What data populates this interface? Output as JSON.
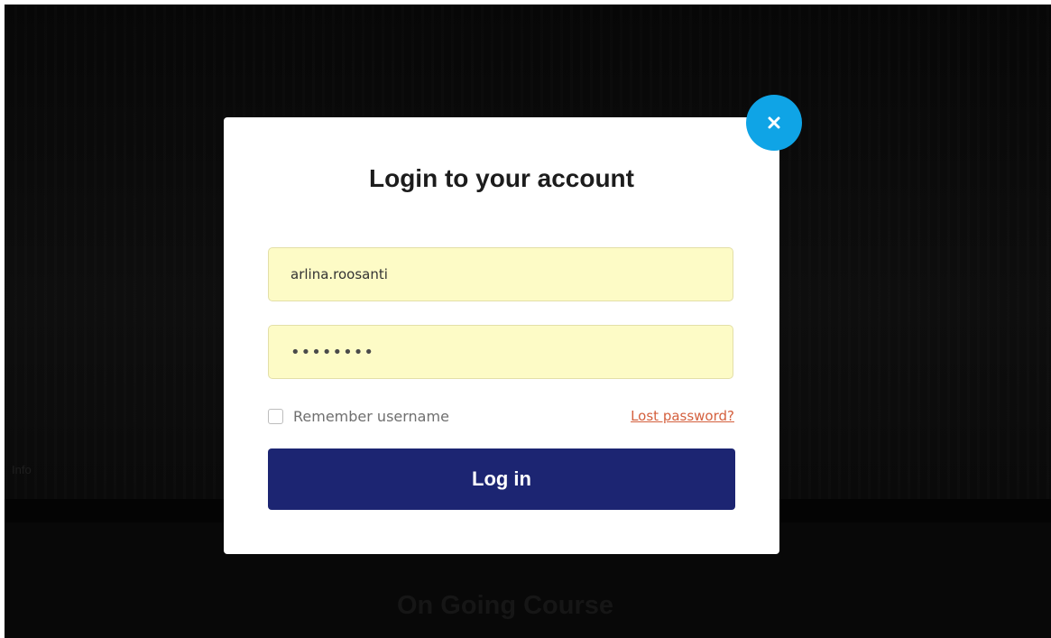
{
  "background": {
    "hero_caption": "Info",
    "section_title": "On Going Course"
  },
  "login_modal": {
    "title": "Login to your account",
    "username_value": "arlina.roosanti",
    "password_value": "••••••••",
    "remember_label": "Remember username",
    "remember_checked": false,
    "lost_password_label": "Lost password?",
    "login_button_label": "Log in",
    "close_icon": "close-icon"
  },
  "colors": {
    "accent": "#0fa4e6",
    "primary_button": "#1c2572",
    "input_autofill": "#fdfbc6",
    "link": "#d4603e"
  }
}
